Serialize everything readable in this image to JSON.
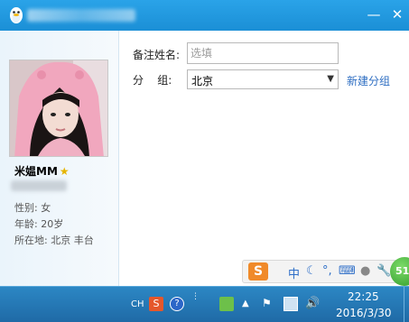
{
  "window": {
    "minimize_glyph": "—",
    "close_glyph": "✕"
  },
  "profile": {
    "nickname": "米媪MM",
    "gender": "性别: 女",
    "age": "年龄: 20岁",
    "location": "所在地: 北京  丰台"
  },
  "form": {
    "remark_label": "备注姓名:",
    "remark_placeholder": "选填",
    "group_label": "分    组:",
    "group_value": "北京",
    "new_group_link": "新建分组"
  },
  "ime": {
    "logo": "S",
    "mode": "中",
    "punct": "°,",
    "badge": "51"
  },
  "taskbar": {
    "lang": "CH",
    "time": "22:25",
    "date": "2016/3/30"
  },
  "colors": {
    "titlebar": "#1b8fd6",
    "link": "#2e6ec2",
    "taskbar": "#1f6aa6"
  }
}
